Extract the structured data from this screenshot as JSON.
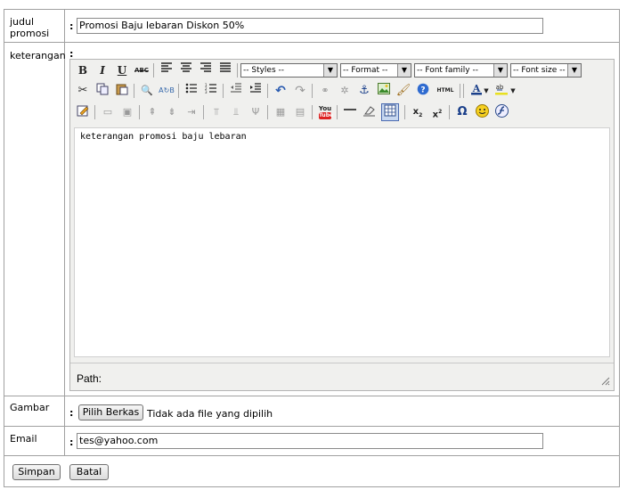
{
  "form": {
    "judul": {
      "label": "judul\npromosi",
      "colon": ":",
      "value": "Promosi Baju lebaran Diskon 50%"
    },
    "keterangan": {
      "label": "keterangan",
      "colon": ":"
    },
    "gambar": {
      "label": "Gambar",
      "colon": ":",
      "button": "Pilih Berkas",
      "status": "Tidak ada file yang dipilih"
    },
    "email": {
      "label": "Email",
      "colon": ":",
      "value": "tes@yahoo.com"
    },
    "actions": {
      "save": "Simpan",
      "cancel": "Batal"
    }
  },
  "editor": {
    "toolbar1": {
      "bold": "B",
      "italic": "I",
      "underline": "U",
      "strike": "ABC",
      "styles": "-- Styles --",
      "format": "-- Format --",
      "fontfamily": "-- Font family --",
      "fontsize": "-- Font size --"
    },
    "toolbar2": {
      "html": "HTML"
    },
    "toolbar3": {
      "youtube": "You",
      "youtube2": "Tube"
    },
    "content": "keterangan promosi baju lebaran",
    "path_label": "Path:"
  }
}
